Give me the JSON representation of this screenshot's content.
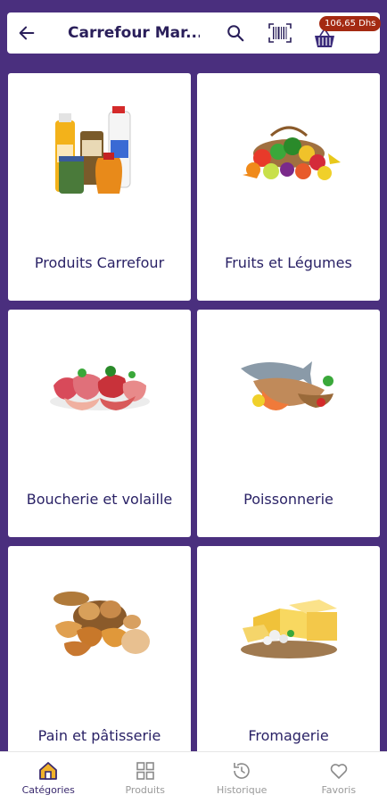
{
  "header": {
    "title": "Carrefour Mar...",
    "cart_total": "106,65 Dhs",
    "icons": [
      "back-arrow-icon",
      "search-icon",
      "barcode-scan-icon",
      "cart-basket-icon"
    ]
  },
  "categories": [
    {
      "label": "Produits Carrefour",
      "icon": "grocery-products-image"
    },
    {
      "label": "Fruits et Légumes",
      "icon": "fruits-vegetables-image"
    },
    {
      "label": "Boucherie et volaille",
      "icon": "meat-image"
    },
    {
      "label": "Poissonnerie",
      "icon": "fish-image"
    },
    {
      "label": "Pain et pâtisserie",
      "icon": "bread-pastry-image"
    },
    {
      "label": "Fromagerie",
      "icon": "cheese-image"
    }
  ],
  "bottom_nav": [
    {
      "label": "Catégories",
      "active": true,
      "icon": "home-icon"
    },
    {
      "label": "Produits",
      "active": false,
      "icon": "grid-icon"
    },
    {
      "label": "Historique",
      "active": false,
      "icon": "history-icon"
    },
    {
      "label": "Favoris",
      "active": false,
      "icon": "heart-icon"
    }
  ],
  "colors": {
    "background": "#4a2f7e",
    "title": "#2a1f5a",
    "badge": "#a42a12",
    "nav_active_icon": "#e0a31a"
  }
}
